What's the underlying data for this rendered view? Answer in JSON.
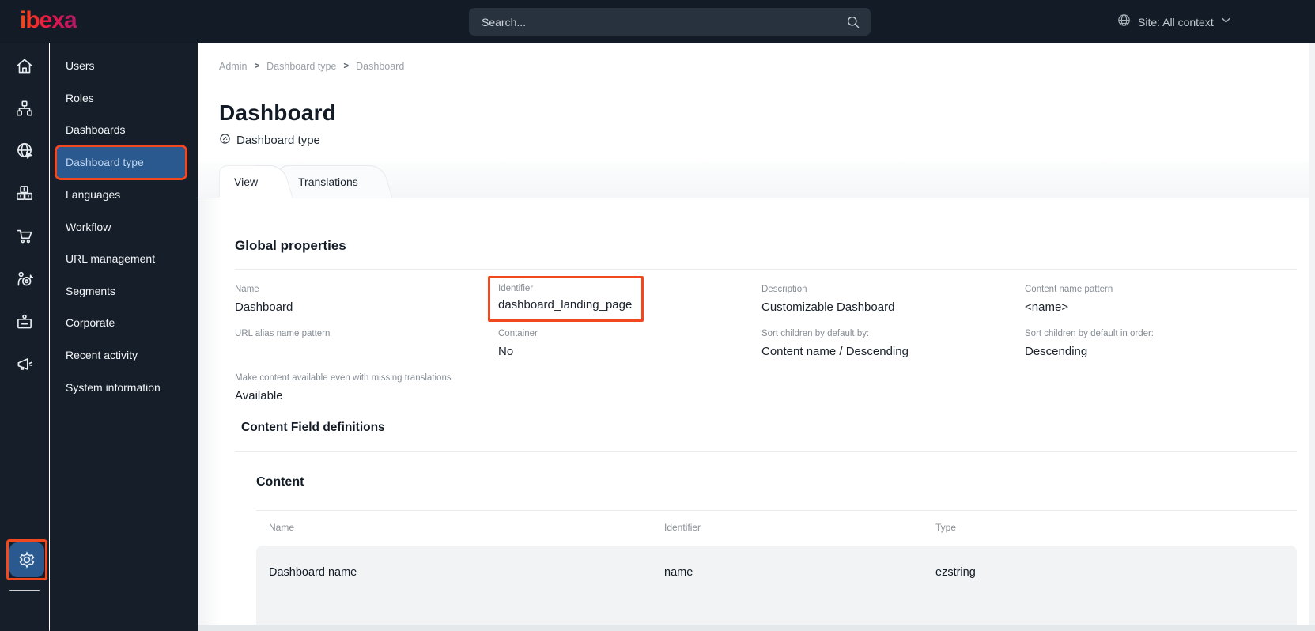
{
  "topbar": {
    "logo_text": "ibexa",
    "search_placeholder": "Search...",
    "site_label": "Site: All context"
  },
  "icon_rail": {
    "icons": [
      "home-icon",
      "content-tree-icon",
      "site-globe-icon",
      "products-icon",
      "commerce-cart-icon",
      "personalization-icon",
      "corporate-badge-icon",
      "marketing-megaphone-icon"
    ],
    "settings_icon": "settings-gear-icon"
  },
  "sidebar": {
    "active_item": "Dashboard type",
    "items": [
      {
        "label": "Users"
      },
      {
        "label": "Roles"
      },
      {
        "label": "Dashboards"
      },
      {
        "label": "Dashboard type"
      },
      {
        "label": "Languages"
      },
      {
        "label": "Workflow"
      },
      {
        "label": "URL management"
      },
      {
        "label": "Segments"
      },
      {
        "label": "Corporate"
      },
      {
        "label": "Recent activity"
      },
      {
        "label": "System information"
      }
    ]
  },
  "breadcrumb": {
    "separator": ">",
    "items": [
      "Admin",
      "Dashboard type",
      "Dashboard"
    ]
  },
  "page_header": {
    "title": "Dashboard",
    "type_label": "Dashboard type"
  },
  "tabs": [
    {
      "label": "View",
      "active": true
    },
    {
      "label": "Translations",
      "active": false
    }
  ],
  "global_properties": {
    "heading": "Global properties",
    "fields": [
      {
        "label": "Name",
        "value": "Dashboard"
      },
      {
        "label": "Identifier",
        "value": "dashboard_landing_page",
        "highlighted": true
      },
      {
        "label": "Description",
        "value": "Customizable Dashboard"
      },
      {
        "label": "Content name pattern",
        "value": "<name>"
      },
      {
        "label": "URL alias name pattern",
        "value": ""
      },
      {
        "label": "Container",
        "value": "No"
      },
      {
        "label": "Sort children by default by:",
        "value": "Content name / Descending"
      },
      {
        "label": "Sort children by default in order:",
        "value": "Descending"
      },
      {
        "label": "Make content available even with missing translations",
        "value": "Available"
      }
    ]
  },
  "content_field_definitions": {
    "heading": "Content Field definitions",
    "group_heading": "Content",
    "table": {
      "headers": [
        "Name",
        "Identifier",
        "Type"
      ],
      "rows": [
        {
          "cells": [
            "Dashboard name",
            "name",
            "ezstring"
          ]
        }
      ]
    }
  },
  "colors": {
    "annotation_orange": "#f1481f",
    "active_item_blue": "#2a598f",
    "topbar_dark": "#131c26"
  }
}
